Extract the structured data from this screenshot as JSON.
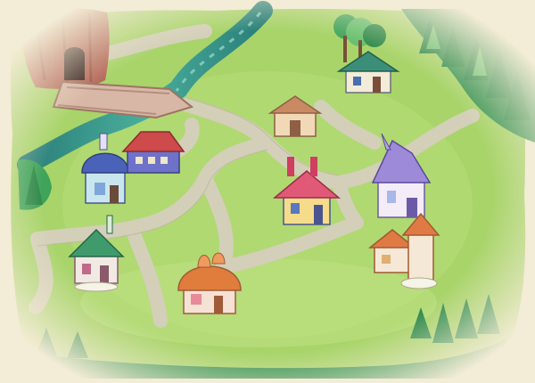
{
  "map": {
    "colors": {
      "parchment": "#f3ecd6",
      "grass": "#a8d46a",
      "grass_light": "#c4e486",
      "grass_dark": "#8cbf4f",
      "path": "#d3cfb8",
      "path_edge": "#bdb79d",
      "river": "#2e8f86",
      "river_light": "#5fc0ad",
      "cliff": "#b5695a",
      "cliff_dark": "#8e4c40",
      "bridge": "#d9b7a6",
      "tree_dark": "#2f8a4a",
      "tree_mid": "#3fa35a",
      "tree_light": "#66c06e"
    },
    "locations": [
      {
        "id": "mountain-tunnel",
        "icon": "tunnel-icon"
      },
      {
        "id": "stone-bridge",
        "icon": "bridge-icon"
      },
      {
        "id": "forest-house",
        "icon": "house-icon",
        "roof": "#3b8f78",
        "wall": "#f2ecd9"
      },
      {
        "id": "gazebo-hut",
        "icon": "hut-icon",
        "roof": "#c98a63",
        "wall": "#f1d9b8"
      },
      {
        "id": "blue-dome-shop",
        "icon": "shop-icon",
        "roof": "#4a63b8",
        "wall": "#c9e6ef"
      },
      {
        "id": "red-barn",
        "icon": "barn-icon",
        "roof": "#cf4a4a",
        "wall": "#6f72c9"
      },
      {
        "id": "pink-roof-house",
        "icon": "house-icon",
        "roof": "#e05a78",
        "wall": "#f4dc8a"
      },
      {
        "id": "purple-spire-house",
        "icon": "spire-house-icon",
        "roof": "#9d8ad8",
        "wall": "#f4ecf7"
      },
      {
        "id": "orange-tower-shop",
        "icon": "tower-icon",
        "roof": "#e07a44",
        "wall": "#f6e8d6"
      },
      {
        "id": "green-clinic",
        "icon": "clinic-icon",
        "roof": "#3f9b6c",
        "wall": "#f1e9e4"
      },
      {
        "id": "orange-dome-house",
        "icon": "dome-house-icon",
        "roof": "#e07c3c",
        "wall": "#f6e1d5"
      }
    ]
  }
}
